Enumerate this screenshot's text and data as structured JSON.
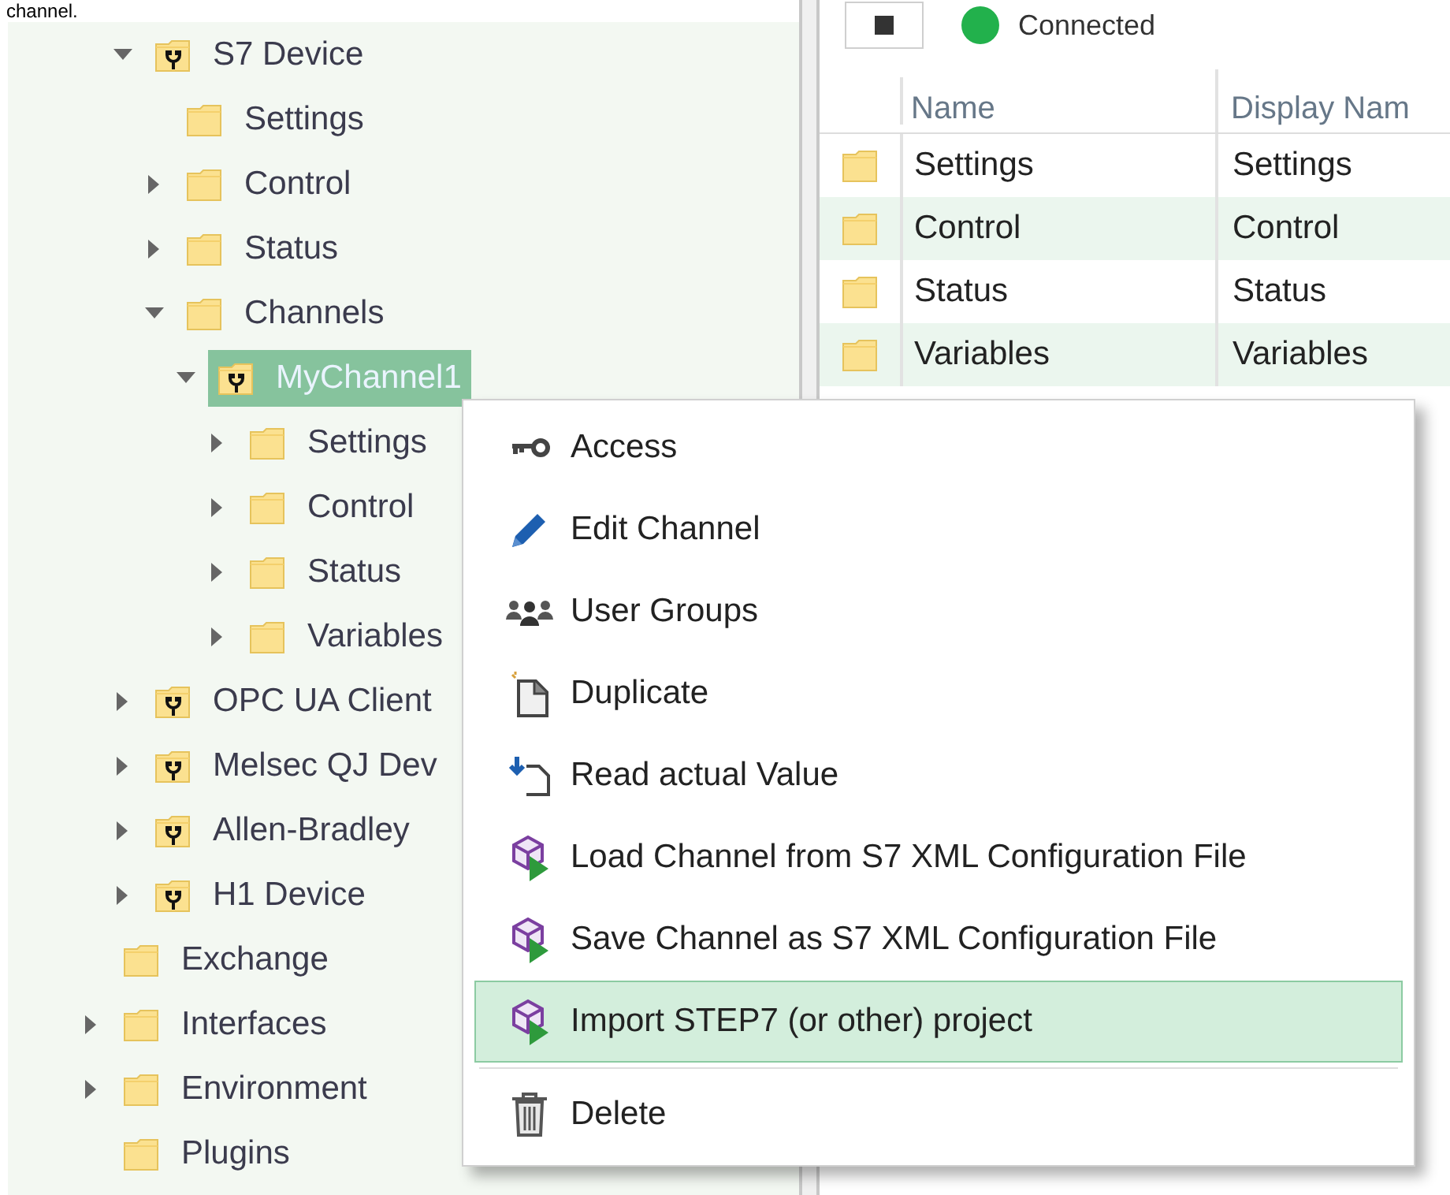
{
  "caption": "channel.",
  "tree": {
    "device_nodes": [
      {
        "label": "S7 Device",
        "kind": "device",
        "expandable": true,
        "expanded": true,
        "selected": false,
        "children": [
          {
            "label": "Settings",
            "kind": "folder",
            "expandable": false,
            "selected": false
          },
          {
            "label": "Control",
            "kind": "folder",
            "expandable": true,
            "expanded": false,
            "selected": false
          },
          {
            "label": "Status",
            "kind": "folder",
            "expandable": true,
            "expanded": false,
            "selected": false
          },
          {
            "label": "Channels",
            "kind": "folder",
            "expandable": true,
            "expanded": true,
            "selected": false,
            "children": [
              {
                "label": "MyChannel1",
                "kind": "device",
                "expandable": true,
                "expanded": true,
                "selected": true,
                "children": [
                  {
                    "label": "Settings",
                    "kind": "folder",
                    "expandable": true,
                    "expanded": false,
                    "selected": false
                  },
                  {
                    "label": "Control",
                    "kind": "folder",
                    "expandable": true,
                    "expanded": false,
                    "selected": false
                  },
                  {
                    "label": "Status",
                    "kind": "folder",
                    "expandable": true,
                    "expanded": false,
                    "selected": false
                  },
                  {
                    "label": "Variables",
                    "kind": "folder",
                    "expandable": true,
                    "expanded": false,
                    "selected": false
                  }
                ]
              }
            ]
          }
        ]
      },
      {
        "label": "OPC UA Client",
        "kind": "device",
        "expandable": true,
        "expanded": false,
        "selected": false
      },
      {
        "label": "Melsec QJ Dev",
        "kind": "device",
        "expandable": true,
        "expanded": false,
        "selected": false
      },
      {
        "label": "Allen-Bradley",
        "kind": "device",
        "expandable": true,
        "expanded": false,
        "selected": false
      },
      {
        "label": "H1 Device",
        "kind": "device",
        "expandable": true,
        "expanded": false,
        "selected": false
      }
    ],
    "folder_nodes": [
      {
        "label": "Exchange",
        "kind": "folder",
        "expandable": false,
        "selected": false
      },
      {
        "label": "Interfaces",
        "kind": "folder",
        "expandable": true,
        "expanded": false,
        "selected": false
      },
      {
        "label": "Environment",
        "kind": "folder",
        "expandable": true,
        "expanded": false,
        "selected": false
      },
      {
        "label": "Plugins",
        "kind": "folder",
        "expandable": false,
        "selected": false
      }
    ]
  },
  "connection": {
    "status": "Connected",
    "color": "#22b14c"
  },
  "table": {
    "columns": [
      "Name",
      "Display Nam"
    ],
    "rows": [
      {
        "cells": [
          "Settings",
          "Settings"
        ]
      },
      {
        "cells": [
          "Control",
          "Control"
        ]
      },
      {
        "cells": [
          "Status",
          "Status"
        ]
      },
      {
        "cells": [
          "Variables",
          "Variables"
        ]
      }
    ]
  },
  "context_menu": {
    "items": [
      {
        "label": "Access",
        "selected": false,
        "divider_before": false
      },
      {
        "label": "Edit Channel",
        "selected": false,
        "divider_before": false
      },
      {
        "label": "User Groups",
        "selected": false,
        "divider_before": false
      },
      {
        "label": "Duplicate",
        "selected": false,
        "divider_before": false
      },
      {
        "label": "Read actual Value",
        "selected": false,
        "divider_before": false
      },
      {
        "label": "Load Channel from S7 XML Configuration File",
        "selected": false,
        "divider_before": false
      },
      {
        "label": "Save Channel as S7 XML Configuration File",
        "selected": false,
        "divider_before": false
      },
      {
        "label": "Import STEP7 (or other) project",
        "selected": true,
        "divider_before": false
      },
      {
        "label": "Delete",
        "selected": false,
        "divider_before": true
      }
    ]
  }
}
